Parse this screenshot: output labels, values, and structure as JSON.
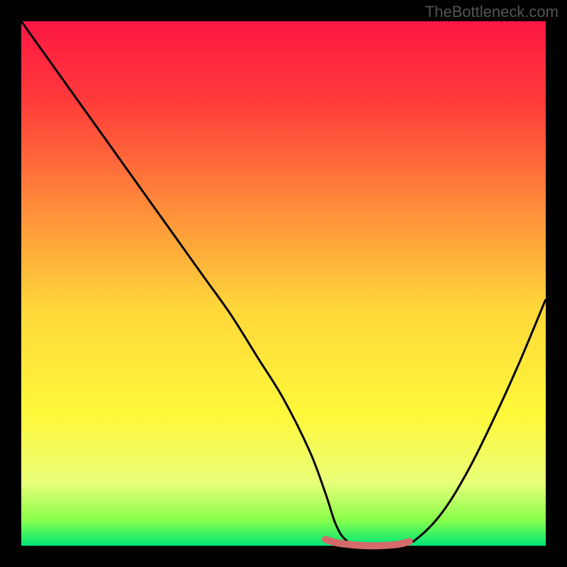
{
  "watermark": "TheBottleneck.com",
  "chart_data": {
    "type": "line",
    "title": "",
    "xlabel": "",
    "ylabel": "",
    "xlim": [
      0,
      100
    ],
    "ylim": [
      0,
      100
    ],
    "background_gradient": {
      "stops": [
        {
          "offset": 0,
          "color": "#ff1744"
        },
        {
          "offset": 0.15,
          "color": "#ff3a3a"
        },
        {
          "offset": 0.35,
          "color": "#ff8a3a"
        },
        {
          "offset": 0.55,
          "color": "#ffd83a"
        },
        {
          "offset": 0.75,
          "color": "#fff83a"
        },
        {
          "offset": 0.88,
          "color": "#e8ff7a"
        },
        {
          "offset": 0.95,
          "color": "#8aff4a"
        },
        {
          "offset": 1.0,
          "color": "#00e676"
        }
      ]
    },
    "series": [
      {
        "name": "bottleneck-curve",
        "type": "line",
        "color": "#000000",
        "x": [
          0,
          5,
          10,
          15,
          20,
          25,
          30,
          35,
          40,
          45,
          50,
          55,
          58,
          60,
          62,
          65,
          70,
          72,
          75,
          80,
          85,
          90,
          95,
          100
        ],
        "y": [
          100,
          93,
          86,
          79,
          72,
          65,
          58,
          51,
          44,
          36,
          28,
          18,
          10,
          4,
          1,
          0,
          0,
          0,
          1,
          6,
          14,
          24,
          35,
          47
        ]
      },
      {
        "name": "optimal-region",
        "type": "marker",
        "color": "#d46a6a",
        "x": [
          58,
          60,
          62,
          64,
          66,
          68,
          70,
          72,
          74
        ],
        "y": [
          1.2,
          0.6,
          0.3,
          0.1,
          0,
          0,
          0.1,
          0.3,
          0.8
        ]
      }
    ]
  }
}
